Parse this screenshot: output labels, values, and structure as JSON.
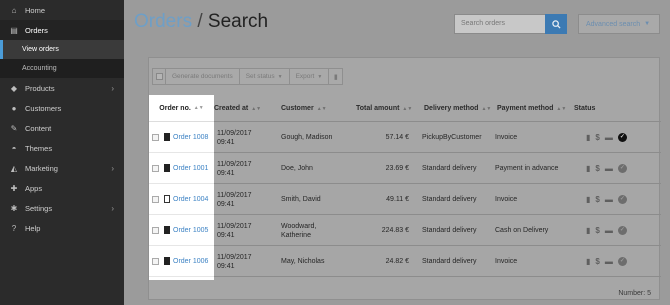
{
  "sidebar": {
    "items": [
      {
        "label": "Home",
        "icon": "home-icon",
        "glyph": "⌂"
      },
      {
        "label": "Orders",
        "icon": "orders-icon",
        "glyph": "▤",
        "active": true
      },
      {
        "label": "Products",
        "icon": "tag-icon",
        "glyph": "◆",
        "chevron": true
      },
      {
        "label": "Customers",
        "icon": "user-icon",
        "glyph": "●"
      },
      {
        "label": "Content",
        "icon": "pencil-icon",
        "glyph": "✎"
      },
      {
        "label": "Themes",
        "icon": "drop-icon",
        "glyph": "◓"
      },
      {
        "label": "Marketing",
        "icon": "megaphone-icon",
        "glyph": "◭",
        "chevron": true
      },
      {
        "label": "Apps",
        "icon": "puzzle-icon",
        "glyph": "✚"
      },
      {
        "label": "Settings",
        "icon": "gear-icon",
        "glyph": "✱",
        "chevron": true
      },
      {
        "label": "Help",
        "icon": "help-icon",
        "glyph": "?"
      }
    ],
    "orders_sub": [
      "View orders",
      "Accounting"
    ]
  },
  "header": {
    "crumb": "Orders",
    "separator": " / ",
    "title": "Search",
    "search_placeholder": "Search orders",
    "advanced_search": "Advanced search"
  },
  "toolbar": {
    "generate": "Generate documents",
    "set_status": "Set status",
    "export": "Export"
  },
  "table": {
    "headers": [
      "Order no.",
      "Created at",
      "Customer",
      "Total amount",
      "Delivery method",
      "Payment method",
      "Status"
    ],
    "rows": [
      {
        "order": "Order 1008",
        "date": "11/09/2017",
        "time": "09:41",
        "customer": "Gough, Madison",
        "customer2": "",
        "total": "57.14 €",
        "delivery": "PickupByCustomer",
        "payment": "Invoice",
        "done": true,
        "edit": false
      },
      {
        "order": "Order 1001",
        "date": "11/09/2017",
        "time": "09:41",
        "customer": "Doe, John",
        "customer2": "",
        "total": "23.69 €",
        "delivery": "Standard delivery",
        "payment": "Payment in advance",
        "done": false,
        "edit": false
      },
      {
        "order": "Order 1004",
        "date": "11/09/2017",
        "time": "09:41",
        "customer": "Smith, David",
        "customer2": "",
        "total": "49.11 €",
        "delivery": "Standard delivery",
        "payment": "Invoice",
        "done": false,
        "edit": true
      },
      {
        "order": "Order 1005",
        "date": "11/09/2017",
        "time": "09:41",
        "customer": "Woodward,",
        "customer2": "Katherine",
        "total": "224.83 €",
        "delivery": "Standard delivery",
        "payment": "Cash on Delivery",
        "done": false,
        "edit": false
      },
      {
        "order": "Order 1006",
        "date": "11/09/2017",
        "time": "09:41",
        "customer": "May, Nicholas",
        "customer2": "",
        "total": "24.82 €",
        "delivery": "Standard delivery",
        "payment": "Invoice",
        "done": false,
        "edit": false
      }
    ],
    "number_label": "Number: 5"
  },
  "colors": {
    "accent": "#3c82c4",
    "sidebar": "#2b2b2b"
  }
}
